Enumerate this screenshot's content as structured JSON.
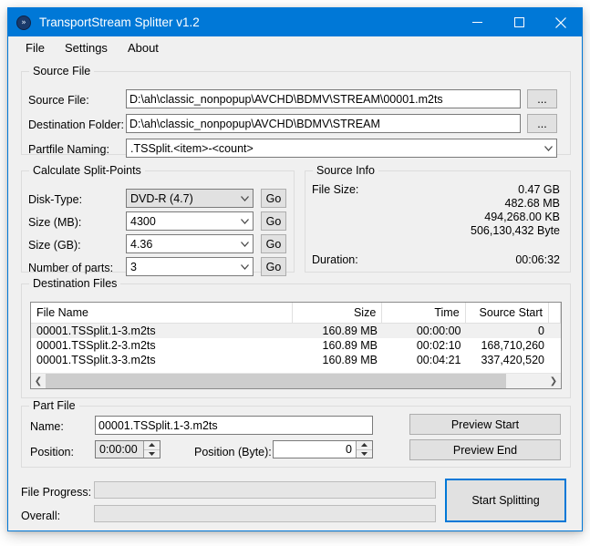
{
  "window": {
    "title": "TransportStream Splitter v1.2",
    "app_icon": "chevron-double-right-icon",
    "minimize_label": "─",
    "maximize_label": "□",
    "close_label": "✕",
    "accent_color": "#0078d7",
    "face_color": "#f0f0f0"
  },
  "menu": {
    "items": [
      {
        "label": "File"
      },
      {
        "label": "Settings"
      },
      {
        "label": "About"
      }
    ]
  },
  "source_file_group": {
    "legend": "Source File",
    "source_file_label": "Source File:",
    "source_file_value": "D:\\ah\\classic_nonpopup\\AVCHD\\BDMV\\STREAM\\00001.m2ts",
    "source_file_browse": "...",
    "destination_folder_label": "Destination Folder:",
    "destination_folder_value": "D:\\ah\\classic_nonpopup\\AVCHD\\BDMV\\STREAM",
    "destination_folder_browse": "...",
    "partfile_naming_label": "Partfile Naming:",
    "partfile_naming_value": ".TSSplit.<item>-<count>"
  },
  "split_points_group": {
    "legend": "Calculate Split-Points",
    "rows": [
      {
        "label": "Disk-Type:",
        "value": "DVD-R (4.7)",
        "go": "Go",
        "style": "grey"
      },
      {
        "label": "Size (MB):",
        "value": "4300",
        "go": "Go",
        "style": "white"
      },
      {
        "label": "Size (GB):",
        "value": "4.36",
        "go": "Go",
        "style": "white"
      },
      {
        "label": "Number of parts:",
        "value": "3",
        "go": "Go",
        "style": "white"
      }
    ]
  },
  "source_info_group": {
    "legend": "Source Info",
    "file_size_label": "File Size:",
    "file_size_values": [
      "0.47 GB",
      "482.68 MB",
      "494,268.00 KB",
      "506,130,432 Byte"
    ],
    "duration_label": "Duration:",
    "duration_value": "00:06:32"
  },
  "destination_files_group": {
    "legend": "Destination Files",
    "columns": [
      "File Name",
      "Size",
      "Time",
      "Source Start"
    ],
    "rows": [
      {
        "name": "00001.TSSplit.1-3.m2ts",
        "size": "160.89 MB",
        "time": "00:00:00",
        "start": "0",
        "selected": true
      },
      {
        "name": "00001.TSSplit.2-3.m2ts",
        "size": "160.89 MB",
        "time": "00:02:10",
        "start": "168,710,260",
        "selected": false
      },
      {
        "name": "00001.TSSplit.3-3.m2ts",
        "size": "160.89 MB",
        "time": "00:04:21",
        "start": "337,420,520",
        "selected": false
      }
    ],
    "scroll_left_icon": "chevron-left-icon",
    "scroll_right_icon": "chevron-right-icon"
  },
  "part_file_group": {
    "legend": "Part File",
    "name_label": "Name:",
    "name_value": "00001.TSSplit.1-3.m2ts",
    "position_label": "Position:",
    "position_value": "0:00:00",
    "position_byte_label": "Position (Byte):",
    "position_byte_value": "0",
    "preview_start_label": "Preview Start",
    "preview_end_label": "Preview End"
  },
  "footer": {
    "file_progress_label": "File Progress:",
    "overall_label": "Overall:",
    "file_progress_percent": 0,
    "overall_percent": 0,
    "start_button_label": "Start Splitting"
  }
}
